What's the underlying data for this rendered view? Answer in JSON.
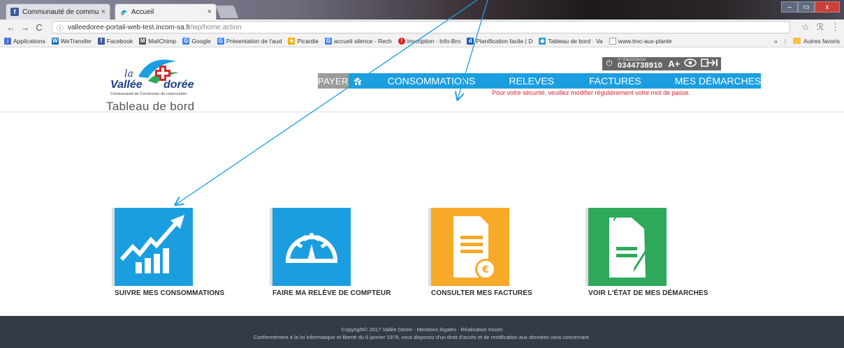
{
  "browser": {
    "tabs": [
      {
        "title": "Communauté de commu",
        "close": "×"
      },
      {
        "title": "Accueil",
        "close": "×"
      }
    ],
    "window_controls": {
      "minimize": "–",
      "maximize": "▭",
      "close": "x"
    },
    "nav": {
      "back": "←",
      "forward": "→",
      "reload": "C"
    },
    "address": {
      "info_icon": "ⓘ",
      "host": "valleedoree-portail-web-test.incom-sa.fr",
      "path": "/wp/home.action"
    },
    "toolbar_icons": {
      "star": "☆",
      "extension": "ℛ",
      "menu": "⋮"
    },
    "bookmarks": [
      {
        "icon": "apps-icon",
        "label": "Applications",
        "color": "#4a6fd1"
      },
      {
        "icon": "wetransfer-icon",
        "label": "WeTransfer",
        "color": "#1a73b8"
      },
      {
        "icon": "facebook-icon",
        "label": "Facebook",
        "color": "#3b5998"
      },
      {
        "icon": "mailchimp-icon",
        "label": "MailChimp",
        "color": "#555555"
      },
      {
        "icon": "google-icon",
        "label": "Google",
        "color": "#4285f4"
      },
      {
        "icon": "google-icon",
        "label": "Présentation de l'aud",
        "color": "#4285f4"
      },
      {
        "icon": "star-icon",
        "label": "Picardie",
        "color": "#f0b000"
      },
      {
        "icon": "google-icon",
        "label": "accueil silence - Rech",
        "color": "#4285f4"
      },
      {
        "icon": "alert-icon",
        "label": "Inscription - Info-Bro",
        "color": "#d62020"
      },
      {
        "icon": "d-icon",
        "label": "Planification facile | D",
        "color": "#1760c0"
      },
      {
        "icon": "leaf-icon",
        "label": "Tableau de bord · Va",
        "color": "#2a9ad8"
      },
      {
        "icon": "page-icon",
        "label": "www.troc-aux-plante",
        "color": "#999999"
      }
    ],
    "bookmarks_more": "»",
    "other_bookmarks": "Autres favoris"
  },
  "site": {
    "logo": {
      "la": "la",
      "vallee": "Vallée",
      "doree": "dorée",
      "subtitle": "Communauté de Communes du Liancourtois"
    },
    "page_title": "Tableau de bord",
    "assistance": {
      "label": "n° d'assistance",
      "number": "0344738910",
      "font_toggle": "A+",
      "power_icon": "⏻",
      "eye_icon": "👁",
      "logout_icon": "⇥"
    },
    "nav": {
      "pay": "PAYER",
      "home_icon": "⌂",
      "items": [
        "CONSOMMATIONS",
        "RELEVES",
        "FACTURES",
        "MES DÉMARCHES"
      ]
    },
    "warning": "Pour votre sécurité, veuillez modifier régulièrement votre mot de passe.",
    "tiles": [
      {
        "label": "SUIVRE MES CONSOMMATIONS",
        "icon": "chart-growth-icon",
        "color": "#1b9ee0"
      },
      {
        "label": "FAIRE MA RELÈVE DE COMPTEUR",
        "icon": "meter-gauge-icon",
        "color": "#1b9ee0"
      },
      {
        "label": "CONSULTER MES FACTURES",
        "icon": "invoice-euro-icon",
        "color": "#f7a928"
      },
      {
        "label": "VOIR L'ÉTAT DE MES DÉMARCHES",
        "icon": "document-pen-icon",
        "color": "#2ea85b"
      }
    ],
    "footer": {
      "line1": "Copyright© 2017 Vallée Dorée  -  Mentions légales  -  Réalisation Incom",
      "line2": "Conformément à la loi informatique et liberté du 6 janvier 1978, vous disposez d'un droit d'accès et de rectification aux données vous concernant."
    }
  },
  "colors": {
    "nav_blue": "#1b9ee0",
    "pay_grey": "#9c9c9c",
    "warning_red": "#d3243a",
    "footer_bg": "#333b46",
    "arrow": "#1b9ee0"
  }
}
